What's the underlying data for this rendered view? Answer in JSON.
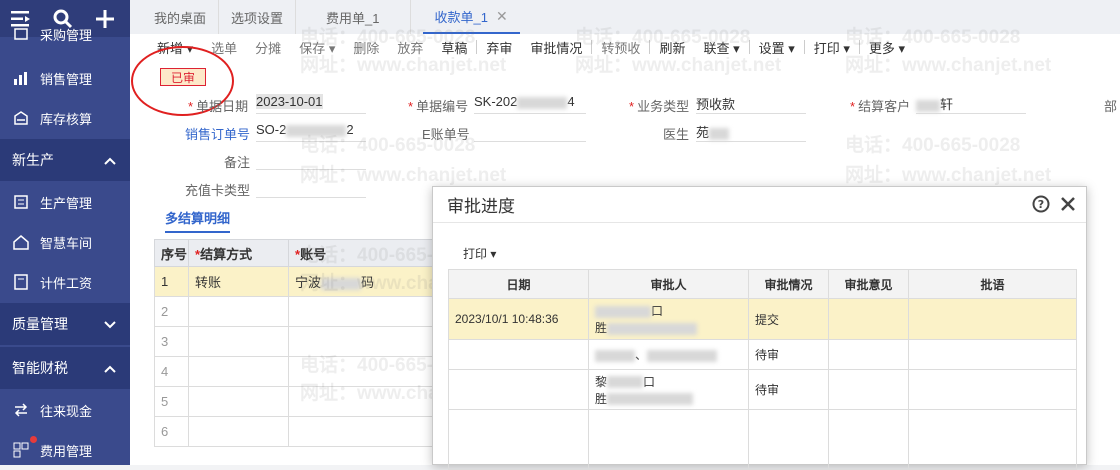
{
  "sidebar": {
    "items": [
      {
        "label": "采购管理",
        "icon": "cart-icon"
      },
      {
        "label": "销售管理",
        "icon": "chart-icon"
      },
      {
        "label": "库存核算",
        "icon": "inventory-icon"
      },
      {
        "label": "生产管理",
        "icon": "production-icon"
      },
      {
        "label": "智慧车间",
        "icon": "workshop-icon"
      },
      {
        "label": "计件工资",
        "icon": "wage-icon"
      },
      {
        "label": "往来现金",
        "icon": "transfer-icon"
      },
      {
        "label": "费用管理",
        "icon": "expense-icon"
      }
    ],
    "groups": {
      "new_production": "新生产",
      "quality": "质量管理",
      "finance": "智能财税"
    }
  },
  "tabs": [
    "我的桌面",
    "选项设置",
    "费用单_1",
    "收款单_1"
  ],
  "toolbar": {
    "add": "新增",
    "select_order": "选单",
    "split": "分摊",
    "save": "保存",
    "delete": "删除",
    "abandon": "放弃",
    "draft": "草稿",
    "reject": "弃审",
    "approval_status": "审批情况",
    "transfer_prepay": "转预收",
    "refresh": "刷新",
    "linked_query": "联查",
    "settings": "设置",
    "print": "打印",
    "more": "更多"
  },
  "status_badge": "已审",
  "form": {
    "doc_date_label": "单据日期",
    "doc_date": "2023-10-01",
    "doc_no_label": "单据编号",
    "doc_no": "SK-202",
    "doc_no_tail": "4",
    "biz_type_label": "业务类型",
    "biz_type": "预收款",
    "settle_customer_label": "结算客户",
    "settle_customer_tail": "轩",
    "dept_label": "部",
    "sales_order_label": "销售订单号",
    "sales_order": "SO-2",
    "sales_order_tail": "2",
    "e_account_label": "E账单号",
    "doctor_label": "医生",
    "doctor_value": "苑",
    "remark_label": "备注",
    "card_type_label": "充值卡类型"
  },
  "subtab": "多结算明细",
  "detail_grid": {
    "headers": [
      "序号",
      "结算方式",
      "账号"
    ],
    "rows": [
      {
        "no": "1",
        "method": "转账",
        "account": "宁波",
        "account_tail": "码"
      },
      {
        "no": "2",
        "method": "",
        "account": ""
      },
      {
        "no": "3",
        "method": "",
        "account": ""
      },
      {
        "no": "4",
        "method": "",
        "account": ""
      },
      {
        "no": "5",
        "method": "",
        "account": ""
      },
      {
        "no": "6",
        "method": "",
        "account": ""
      }
    ]
  },
  "dialog": {
    "title": "审批进度",
    "print": "打印",
    "headers": [
      "日期",
      "审批人",
      "审批情况",
      "审批意见",
      "批语"
    ],
    "rows": [
      {
        "date": "2023/10/1 10:48:36",
        "approver_a": "口",
        "approver_b": "胜",
        "status": "提交",
        "opinion": "",
        "remark": ""
      },
      {
        "date": "",
        "approver_a": "、",
        "approver_b": "",
        "status": "待审",
        "opinion": "",
        "remark": ""
      },
      {
        "date": "",
        "approver_a": "黎",
        "approver_a_tail": "口",
        "approver_b": "胜",
        "status": "待审",
        "opinion": "",
        "remark": ""
      }
    ]
  },
  "watermark": {
    "phone": "电话：400-665-0028",
    "site": "网址：www.chanjet.net"
  }
}
